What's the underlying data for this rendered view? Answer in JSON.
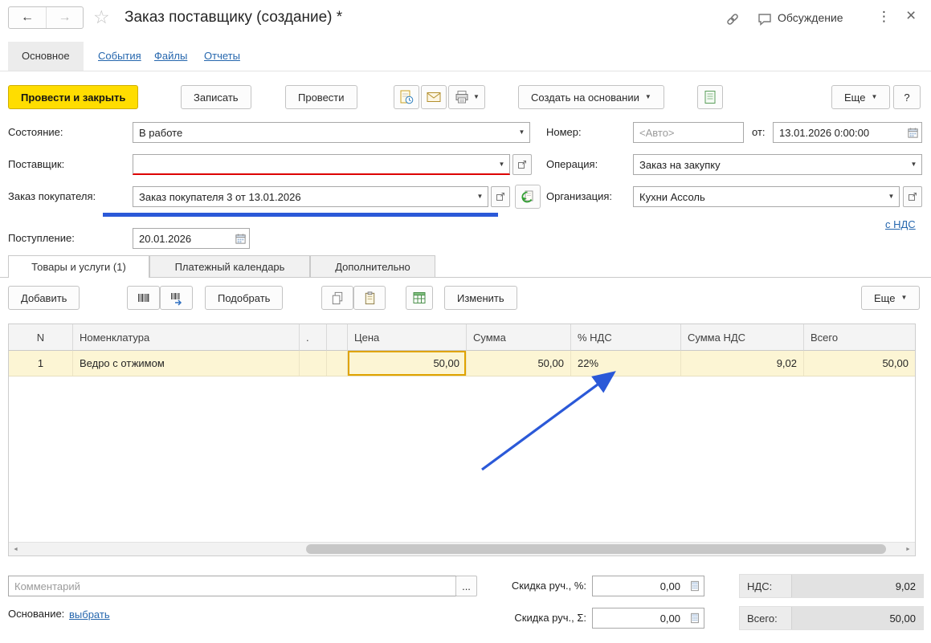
{
  "icons": {
    "back": "←",
    "forward": "→",
    "star": "☆",
    "menu_dots": "⋮",
    "close": "×",
    "dropdown": "▼",
    "ellipsis": "...",
    "scroll_left": "◄",
    "scroll_right": "►"
  },
  "titlebar": {
    "title": "Заказ поставщику (создание) *",
    "discussion": "Обсуждение"
  },
  "nav_tabs": {
    "main": "Основное",
    "events": "События",
    "files": "Файлы",
    "reports": "Отчеты"
  },
  "toolbar": {
    "post_and_close": "Провести и закрыть",
    "save": "Записать",
    "post": "Провести",
    "create_based_on": "Создать на основании",
    "more": "Еще",
    "help": "?"
  },
  "form": {
    "state": {
      "label": "Состояние:",
      "value": "В работе"
    },
    "number": {
      "label": "Номер:",
      "placeholder": "<Авто>"
    },
    "date": {
      "label": "от:",
      "value": "13.01.2026 0:00:00"
    },
    "supplier": {
      "label": "Поставщик:",
      "value": ""
    },
    "operation": {
      "label": "Операция:",
      "value": "Заказ на закупку"
    },
    "customer_order": {
      "label": "Заказ покупателя:",
      "value": "Заказ покупателя 3 от 13.01.2026"
    },
    "organization": {
      "label": "Организация:",
      "value": "Кухни Ассоль"
    },
    "vat_link": "с НДС",
    "receipt": {
      "label": "Поступление:",
      "value": "20.01.2026"
    }
  },
  "tabs": {
    "goods": "Товары и услуги (1)",
    "payment_calendar": "Платежный календарь",
    "additional": "Дополнительно"
  },
  "table_toolbar": {
    "add": "Добавить",
    "pick": "Подобрать",
    "edit": "Изменить",
    "more": "Еще"
  },
  "table": {
    "columns": [
      "N",
      "Номенклатура",
      ".",
      "",
      "Цена",
      "Сумма",
      "% НДС",
      "Сумма НДС",
      "Всего"
    ],
    "rows": [
      {
        "n": "1",
        "name": "Ведро с отжимом",
        "price": "50,00",
        "sum": "50,00",
        "vat": "22%",
        "vat_sum": "9,02",
        "total": "50,00"
      }
    ]
  },
  "footer": {
    "comment_placeholder": "Комментарий",
    "basis_label": "Основание:",
    "basis_link": "выбрать",
    "discount_pct": {
      "label": "Скидка руч., %:",
      "value": "0,00"
    },
    "discount_sum": {
      "label": "Скидка руч., Σ:",
      "value": "0,00"
    },
    "vat_total": {
      "label": "НДС:",
      "value": "9,02"
    },
    "grand_total": {
      "label": "Всего:",
      "value": "50,00"
    }
  }
}
